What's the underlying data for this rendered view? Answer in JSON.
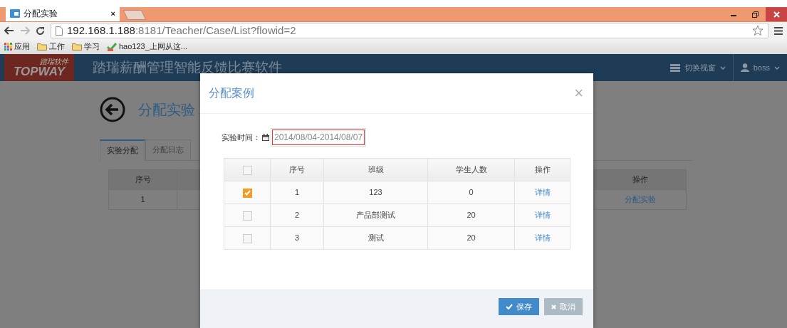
{
  "browser": {
    "tab": {
      "title": "分配实验",
      "close": "×"
    },
    "url": {
      "host": "192.168.1.188",
      "rest": ":8181/Teacher/Case/List?flowid=2"
    },
    "bookmarks": [
      {
        "label": "应用",
        "kind": "apps"
      },
      {
        "label": "工作",
        "kind": "folder"
      },
      {
        "label": "学习",
        "kind": "folder"
      },
      {
        "label": "hao123_上网从这...",
        "kind": "site"
      }
    ]
  },
  "app": {
    "logo": {
      "small": "踏瑞软件",
      "big": "TOPWAY"
    },
    "title": "踏瑞薪酬管理智能反馈比赛软件",
    "nav": [
      {
        "label": "切换视窗",
        "kind": "view"
      },
      {
        "label": "boss",
        "kind": "user"
      }
    ]
  },
  "page": {
    "title": "分配实验",
    "tabs": [
      {
        "label": "实验分配",
        "selected": true
      },
      {
        "label": "分配日志",
        "selected": false
      }
    ],
    "table": {
      "columns": [
        "序号",
        "操作"
      ],
      "rows": [
        [
          "1",
          "分配实验"
        ]
      ]
    }
  },
  "modal": {
    "title": "分配案例",
    "close": "×",
    "date_label": "实验时间：",
    "date_value": "2014/08/04-2014/08/07",
    "date_highlighted": true,
    "table": {
      "select_all_checked": false,
      "columns": [
        "序号",
        "班级",
        "学生人数",
        "操作"
      ],
      "rows": [
        {
          "checked": true,
          "cells": [
            "1",
            "123",
            "0"
          ],
          "action": "详情"
        },
        {
          "checked": false,
          "cells": [
            "2",
            "产品部测试",
            "20"
          ],
          "action": "详情"
        },
        {
          "checked": false,
          "cells": [
            "3",
            "测试",
            "20"
          ],
          "action": "详情"
        }
      ]
    },
    "buttons": [
      {
        "label": "保存",
        "kind": "primary"
      },
      {
        "label": "取消",
        "kind": "cancel"
      }
    ]
  }
}
